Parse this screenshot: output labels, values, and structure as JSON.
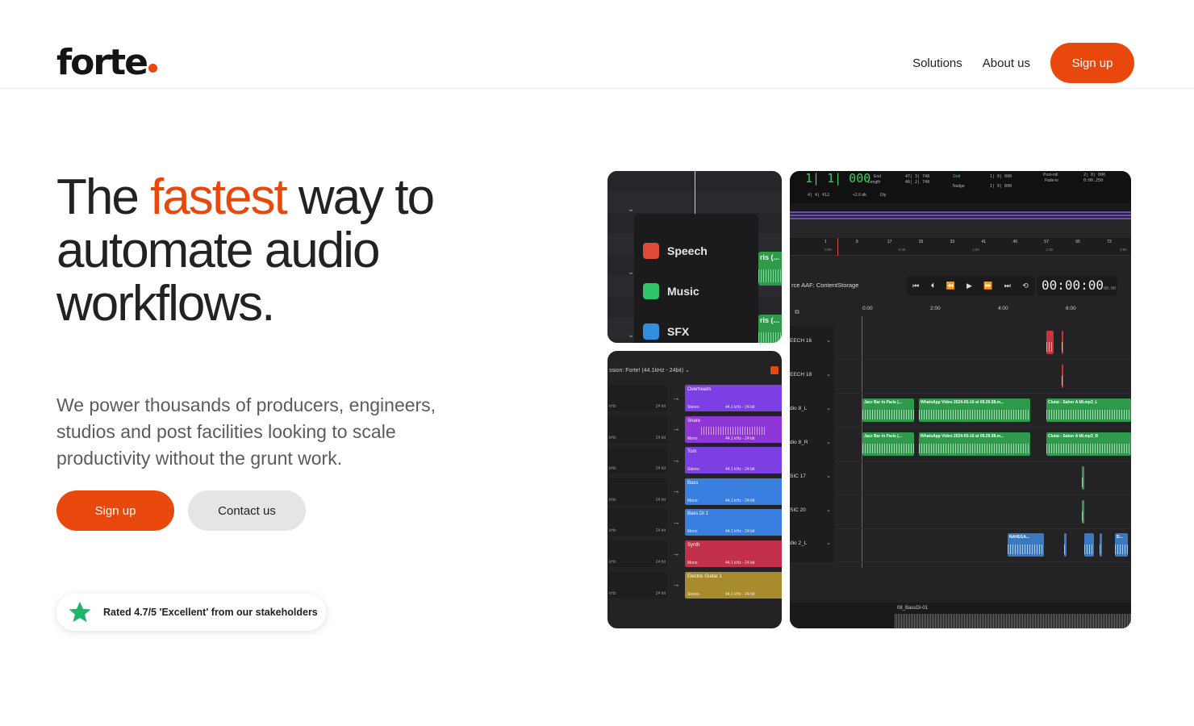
{
  "header": {
    "logo_text": "forte",
    "nav": [
      {
        "label": "Solutions"
      },
      {
        "label": "About us"
      }
    ],
    "cta_label": "Sign up"
  },
  "hero": {
    "title_part1": "The ",
    "title_accent": "fastest",
    "title_part2": " way to automate audio workflows.",
    "subtitle": "We power thousands of producers, engineers, studios and post facilities looking to scale productivity without the grunt work.",
    "primary_cta": "Sign up",
    "secondary_cta": "Contact us",
    "rating_text": "Rated 4.7/5 'Excellent' from our stakeholders"
  },
  "colors": {
    "accent": "#e8480c",
    "rating_star": "#1fb56b"
  },
  "screens": {
    "categories": {
      "items": [
        {
          "label": "Speech",
          "color": "#e04a3a"
        },
        {
          "label": "Music",
          "color": "#2fc46a"
        },
        {
          "label": "SFX",
          "color": "#2f8fe0"
        }
      ],
      "clip_label": "ris (..."
    },
    "session": {
      "title": "ssion: Forte! (44.1kHz - 24bit) ⌄",
      "tracks": [
        {
          "name": "Overheads",
          "format": "Stereo",
          "info": "44.1 kHz - 24 bit",
          "color": "#7b3fe4"
        },
        {
          "name": "Snare",
          "format": "Mono",
          "info": "44.1 kHz - 24 bit",
          "color": "#8e36d6"
        },
        {
          "name": "Tom",
          "format": "Stereo",
          "info": "44.1 kHz - 24 bit",
          "color": "#7b3fe4"
        },
        {
          "name": "Bass",
          "format": "Mono",
          "info": "44.1 kHz - 24 bit",
          "color": "#3a7fe0"
        },
        {
          "name": "Bass DI 1",
          "format": "Mono",
          "info": "44.1 kHz - 24 bit",
          "color": "#3a7fe0"
        },
        {
          "name": "Synth",
          "format": "Mono",
          "info": "44.1 kHz - 24 bit",
          "color": "#c2304a"
        },
        {
          "name": "Electric Guitar 1",
          "format": "Stereo",
          "info": "44.1 kHz - 24 bit",
          "color": "#a88b2c"
        }
      ],
      "left_khz": "kHz",
      "left_bit": "24 bit"
    },
    "daw": {
      "counter": "1| 1| 000",
      "lcd_end_label": "End",
      "lcd_length_label": "Length",
      "lcd_end": "47| 3| 748",
      "lcd_length": "46| 2| 748",
      "lcd_grid": "Grid",
      "lcd_nudge": "Nudge",
      "lcd_grid_val": "1| 0| 000",
      "lcd_nudge_val": "1| 0| 000",
      "lcd_postroll": "Post-roll",
      "lcd_fadein": "Fade-in",
      "lcd_post_val": "2| 0| 000",
      "lcd_fade_val": "0:00.250",
      "lcd_meter": "4| 4| 412",
      "lcd_db": "+2.6 db",
      "lcd_dly": "Dly",
      "ruler_bars": [
        "1",
        "9",
        "17",
        "25",
        "33",
        "41",
        "49",
        "57",
        "65",
        "73"
      ],
      "ruler_times": [
        "0:00",
        "0:30",
        "1:00",
        "1:30",
        "2:00",
        "2:30"
      ],
      "source_label": "rce AAF: ContentStorage",
      "transport_icons": [
        "⏮",
        "⏴",
        "⏪",
        "▶",
        "⏩",
        "⏭",
        "⟲"
      ],
      "timecode": "00:00:00",
      "timecode_frames": "00.00",
      "timeline_ticks": [
        "0:00",
        "2:00",
        "4:00",
        "6:00"
      ],
      "track_labels": [
        "EECH 16",
        "EECH 18",
        "dio 8_L",
        "dio 8_R",
        "SIC 17",
        "SIC 20",
        "dio 2_L"
      ],
      "clip_jazz": "Jazz Bar in Paris (...",
      "clip_whatsapp": "WhatsApp Video 2024-05-16 at 09.29.58.m...",
      "clip_clutai_l": "Clutai - Sabor A Mi.mp3_L",
      "clip_clutai_r": "Clutai - Sabor A Mi.mp3_R",
      "clip_naveg": "NAVEGA...",
      "clip_small": "D...",
      "bottom_clip": "08_BassDI-01"
    }
  }
}
